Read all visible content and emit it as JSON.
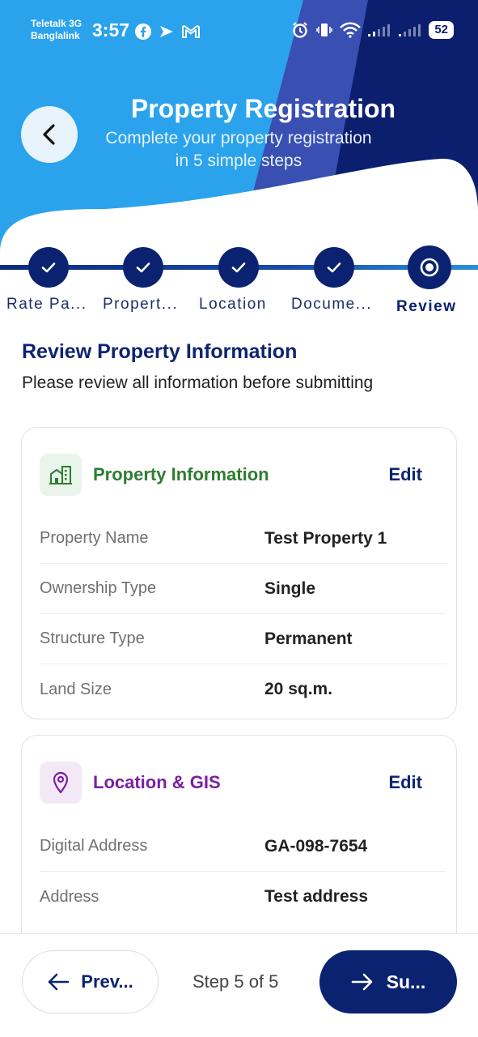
{
  "status_bar": {
    "carrier1": "Teletalk 3G",
    "carrier2": "Banglalink",
    "time": "3:57",
    "battery": "52",
    "icons": [
      "facebook-icon",
      "send-icon",
      "gmail-icon",
      "alarm-icon",
      "vibrate-icon",
      "wifi-icon",
      "signal-icon",
      "signal-icon"
    ]
  },
  "header": {
    "title": "Property Registration",
    "subtitle": "Complete your property registration in 5 simple steps",
    "colors": {
      "light_blue": "#2aa3ec",
      "mid_blue": "#3a4fb2",
      "dark_navy": "#0c1f6e"
    }
  },
  "stepper": {
    "steps": [
      {
        "label": "Rate Pa...",
        "state": "done"
      },
      {
        "label": "Propert...",
        "state": "done"
      },
      {
        "label": "Location",
        "state": "done"
      },
      {
        "label": "Docume...",
        "state": "done"
      },
      {
        "label": "Review",
        "state": "current"
      }
    ]
  },
  "main": {
    "title": "Review Property Information",
    "subtitle": "Please review all information before submitting"
  },
  "cards": {
    "property": {
      "title": "Property Information",
      "edit": "Edit",
      "icon": "building-icon",
      "color": "#2e7d32",
      "rows": [
        {
          "label": "Property Name",
          "value": "Test Property 1"
        },
        {
          "label": "Ownership Type",
          "value": "Single"
        },
        {
          "label": "Structure Type",
          "value": "Permanent"
        },
        {
          "label": "Land Size",
          "value": "20 sq.m."
        }
      ]
    },
    "location": {
      "title": "Location & GIS",
      "edit": "Edit",
      "icon": "location-pin-icon",
      "color": "#7b1fa2",
      "rows": [
        {
          "label": "Digital Address",
          "value": "GA-098-7654"
        },
        {
          "label": "Address",
          "value": "Test address"
        }
      ]
    }
  },
  "footer": {
    "prev_label": "Prev...",
    "step_text": "Step 5 of 5",
    "submit_label": "Su..."
  }
}
